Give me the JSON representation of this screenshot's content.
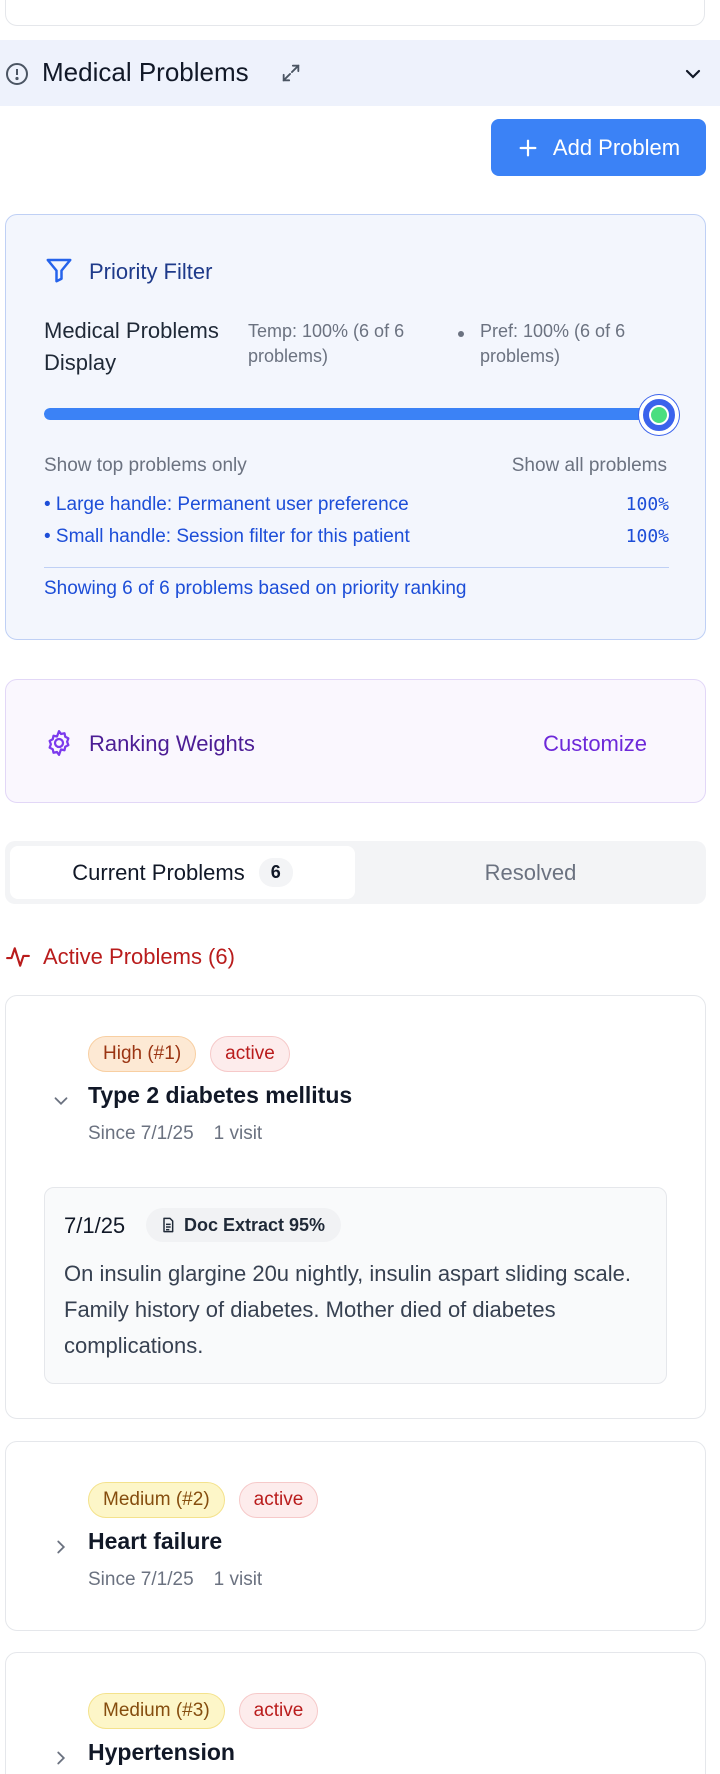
{
  "section": {
    "title": "Medical Problems",
    "icons": {
      "alert": "alert-circle-icon",
      "expand": "expand-icon",
      "collapse": "chevron-down-icon"
    }
  },
  "add_button": {
    "label": "Add Problem",
    "icon": "plus-icon"
  },
  "priority_filter": {
    "title": "Priority Filter",
    "display_label": "Medical Problems Display",
    "temp_text": "Temp: 100% (6 of 6 problems)",
    "pref_text": "Pref: 100% (6 of 6 problems)",
    "slider_level_percent": 100,
    "range_min_label": "Show top problems only",
    "range_max_label": "Show all problems",
    "legend": [
      {
        "label": "• Large handle: Permanent user preference",
        "value": "100%"
      },
      {
        "label": "• Small handle: Session filter for this patient",
        "value": "100%"
      }
    ],
    "summary": "Showing 6 of 6 problems based on priority ranking",
    "colors": {
      "accent": "#3b82f6",
      "text": "#1d4ed8",
      "handle_inner": "#4ade80"
    }
  },
  "ranking_weights": {
    "title": "Ranking Weights",
    "action": "Customize",
    "icon": "gear-icon"
  },
  "tabs": {
    "current": {
      "label": "Current Problems",
      "count": "6"
    },
    "resolved": {
      "label": "Resolved"
    }
  },
  "active_problems": {
    "title": "Active Problems (6)",
    "icon": "activity-icon",
    "items": [
      {
        "priority": "High (#1)",
        "status": "active",
        "name": "Type 2 diabetes mellitus",
        "since": "Since 7/1/25",
        "visits": "1 visit",
        "expanded": true,
        "note": {
          "date": "7/1/25",
          "source": "Doc Extract 95%",
          "text": "On insulin glargine 20u nightly, insulin aspart sliding scale. Family history of diabetes. Mother died of diabetes complications."
        }
      },
      {
        "priority": "Medium (#2)",
        "status": "active",
        "name": "Heart failure",
        "since": "Since 7/1/25",
        "visits": "1 visit",
        "expanded": false
      },
      {
        "priority": "Medium (#3)",
        "status": "active",
        "name": "Hypertension",
        "expanded": false
      }
    ]
  }
}
